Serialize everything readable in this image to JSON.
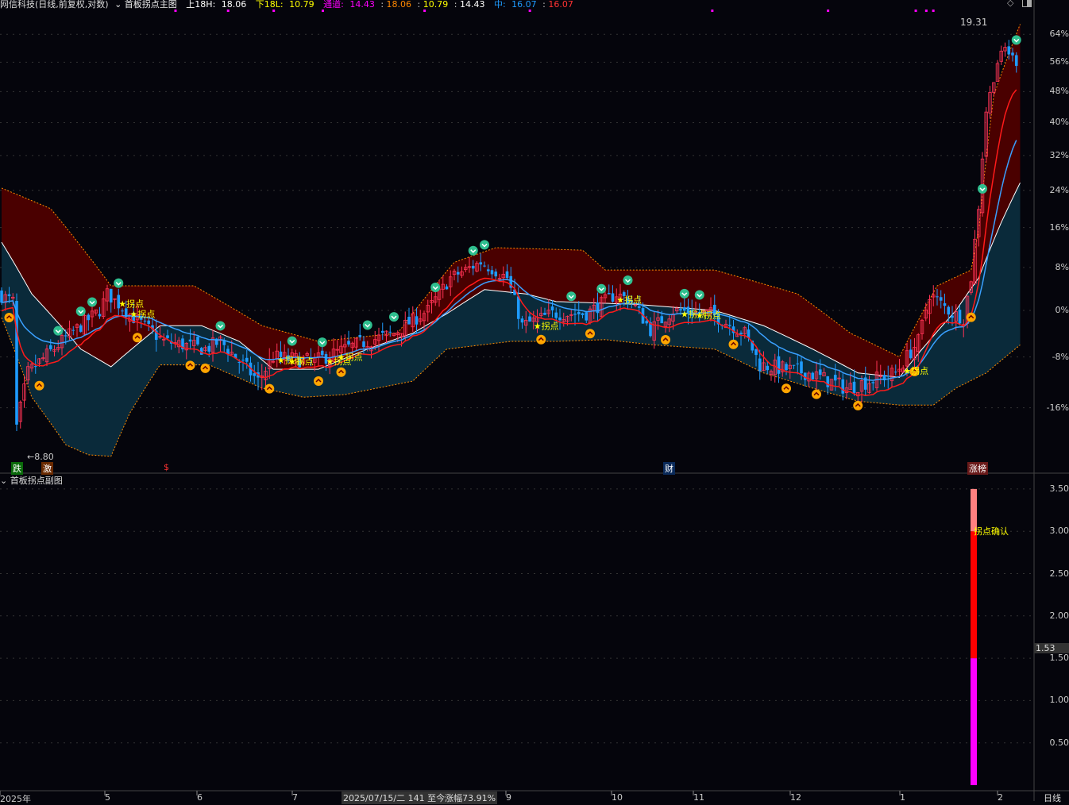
{
  "header": {
    "title": "网信科技(日线,前复权,对数)",
    "indicator": "首板拐点主图",
    "upper_label": "上18H:",
    "upper_value": "18.06",
    "lower_label": "下18L:",
    "lower_value": "10.79",
    "channel_label": "通道:",
    "channel_values": [
      "14.43",
      "18.06",
      "10.79",
      "14.43"
    ],
    "mid_label": "中:",
    "mid_values": [
      "16.07",
      "16.07"
    ]
  },
  "price_labels": {
    "high": "19.31",
    "low": "8.80"
  },
  "tags": {
    "t1": "跌",
    "t2": "激",
    "t3": "$",
    "t4": "财",
    "t5": "涨榜"
  },
  "sub_panel": {
    "title": "首板拐点副图",
    "signal_label": "拐点确认",
    "current_value": "1.53",
    "yticks": [
      "3.50",
      "3.00",
      "2.50",
      "2.00",
      "1.50",
      "1.00",
      "0.50"
    ]
  },
  "xaxis": {
    "labels": [
      "2025年",
      "5",
      "6",
      "7",
      "9",
      "10",
      "11",
      "12",
      "1",
      "2"
    ],
    "cursor_info": "2025/07/15/二 141 至今涨幅73.91%",
    "period": "日线"
  },
  "colors": {
    "up": "#ff3355",
    "down": "#1e9bff",
    "upper_fill": "#4a0000",
    "lower_fill": "#0a2a3a",
    "band": "#ff8c00",
    "mid": "#ffffff",
    "accent_magenta": "#ff00ff"
  },
  "chart_data": {
    "type": "candlestick",
    "title": "网信科技 日线",
    "yaxis": {
      "scale": "log-percent",
      "ticks": [
        "64%",
        "56%",
        "48%",
        "40%",
        "32%",
        "24%",
        "16%",
        "8%",
        "0%",
        "-8%",
        "-16%"
      ],
      "tick_values": [
        64,
        56,
        48,
        40,
        32,
        24,
        16,
        8,
        0,
        -8,
        -16
      ]
    },
    "candles_count": 270,
    "price_pct_anchors": [
      [
        0,
        3
      ],
      [
        4,
        1.6
      ],
      [
        5,
        -19
      ],
      [
        8,
        -10.6
      ],
      [
        17,
        -5.4
      ],
      [
        27,
        0
      ],
      [
        29,
        3
      ],
      [
        36,
        -1.3
      ],
      [
        44,
        -5.4
      ],
      [
        55,
        -6.7
      ],
      [
        59,
        -5.4
      ],
      [
        69,
        -11.9
      ],
      [
        73,
        -8
      ],
      [
        84,
        -8.7
      ],
      [
        95,
        -6
      ],
      [
        105,
        -4
      ],
      [
        114,
        0
      ],
      [
        120,
        6
      ],
      [
        128,
        9
      ],
      [
        135,
        6
      ],
      [
        139,
        -2.7
      ],
      [
        147,
        -0.6
      ],
      [
        156,
        -0.6
      ],
      [
        164,
        3
      ],
      [
        168,
        1.6
      ],
      [
        173,
        -3.4
      ],
      [
        179,
        0
      ],
      [
        189,
        -0.6
      ],
      [
        198,
        -4
      ],
      [
        202,
        -9.3
      ],
      [
        215,
        -10.6
      ],
      [
        225,
        -13
      ],
      [
        238,
        -10.6
      ],
      [
        244,
        -5.4
      ],
      [
        247,
        3
      ],
      [
        253,
        -0.6
      ],
      [
        256,
        -1.3
      ],
      [
        258,
        6
      ],
      [
        260,
        20.5
      ],
      [
        262,
        43
      ],
      [
        265,
        56
      ],
      [
        267,
        60
      ],
      [
        270,
        56
      ]
    ],
    "upper_band_pct": [
      [
        0,
        24.5
      ],
      [
        13,
        20
      ],
      [
        21,
        12.2
      ],
      [
        29,
        4.5
      ],
      [
        51,
        4.5
      ],
      [
        69,
        -2.7
      ],
      [
        84,
        -5.4
      ],
      [
        105,
        -4
      ],
      [
        120,
        9
      ],
      [
        131,
        11.9
      ],
      [
        154,
        11.4
      ],
      [
        160,
        7.5
      ],
      [
        189,
        7.5
      ],
      [
        211,
        3
      ],
      [
        225,
        -4
      ],
      [
        238,
        -8
      ],
      [
        248,
        4.5
      ],
      [
        257,
        7.5
      ],
      [
        259,
        15.5
      ],
      [
        263,
        47
      ],
      [
        270,
        67
      ]
    ],
    "mid_line_pct": [
      [
        0,
        13
      ],
      [
        8,
        3
      ],
      [
        21,
        -6.7
      ],
      [
        29,
        -9.6
      ],
      [
        42,
        -2.7
      ],
      [
        53,
        -2.7
      ],
      [
        63,
        -5.4
      ],
      [
        72,
        -10
      ],
      [
        84,
        -10
      ],
      [
        97,
        -6.7
      ],
      [
        109,
        -4
      ],
      [
        118,
        -0.6
      ],
      [
        128,
        3.8
      ],
      [
        139,
        3
      ],
      [
        147,
        1.6
      ],
      [
        168,
        1.1
      ],
      [
        189,
        0
      ],
      [
        202,
        -2.7
      ],
      [
        215,
        -6.7
      ],
      [
        227,
        -10.6
      ],
      [
        238,
        -11.3
      ],
      [
        244,
        -6.7
      ],
      [
        253,
        0
      ],
      [
        259,
        6
      ],
      [
        265,
        17.1
      ],
      [
        270,
        25.7
      ]
    ],
    "lower_band_pct": [
      [
        0,
        -1.3
      ],
      [
        8,
        -14.4
      ],
      [
        17,
        -21.4
      ],
      [
        23,
        -22.8
      ],
      [
        29,
        -23
      ],
      [
        34,
        -16.8
      ],
      [
        42,
        -9.3
      ],
      [
        55,
        -9.3
      ],
      [
        69,
        -13
      ],
      [
        80,
        -14.4
      ],
      [
        91,
        -14
      ],
      [
        109,
        -11.9
      ],
      [
        118,
        -6.7
      ],
      [
        135,
        -5.4
      ],
      [
        147,
        -5.4
      ],
      [
        160,
        -5.1
      ],
      [
        173,
        -6
      ],
      [
        189,
        -6.7
      ],
      [
        202,
        -10.6
      ],
      [
        215,
        -13
      ],
      [
        227,
        -15
      ],
      [
        238,
        -15.6
      ],
      [
        247,
        -15.6
      ],
      [
        253,
        -13
      ],
      [
        261,
        -10.6
      ],
      [
        270,
        -6
      ]
    ],
    "sell_signals": [
      15,
      21,
      24,
      31,
      58,
      77,
      85,
      97,
      104,
      115,
      125,
      128,
      151,
      159,
      166,
      181,
      185,
      260,
      269
    ],
    "buy_signals": [
      2,
      10,
      36,
      50,
      54,
      71,
      84,
      90,
      143,
      156,
      176,
      194,
      208,
      216,
      227,
      242,
      257
    ],
    "turn_labels": {
      "text": "拐点",
      "at": [
        31,
        34,
        73,
        76,
        86,
        89,
        141,
        163,
        180,
        184,
        239
      ]
    },
    "sub_chart": {
      "type": "bar",
      "yrange": [
        0,
        3.6
      ],
      "bar_index": 258,
      "segments": [
        {
          "from": 0,
          "to": 1.5,
          "color": "#ff00ff"
        },
        {
          "from": 1.5,
          "to": 3.0,
          "color": "#ff0000"
        },
        {
          "from": 3.0,
          "to": 3.5,
          "color": "#ff8080"
        }
      ]
    }
  }
}
